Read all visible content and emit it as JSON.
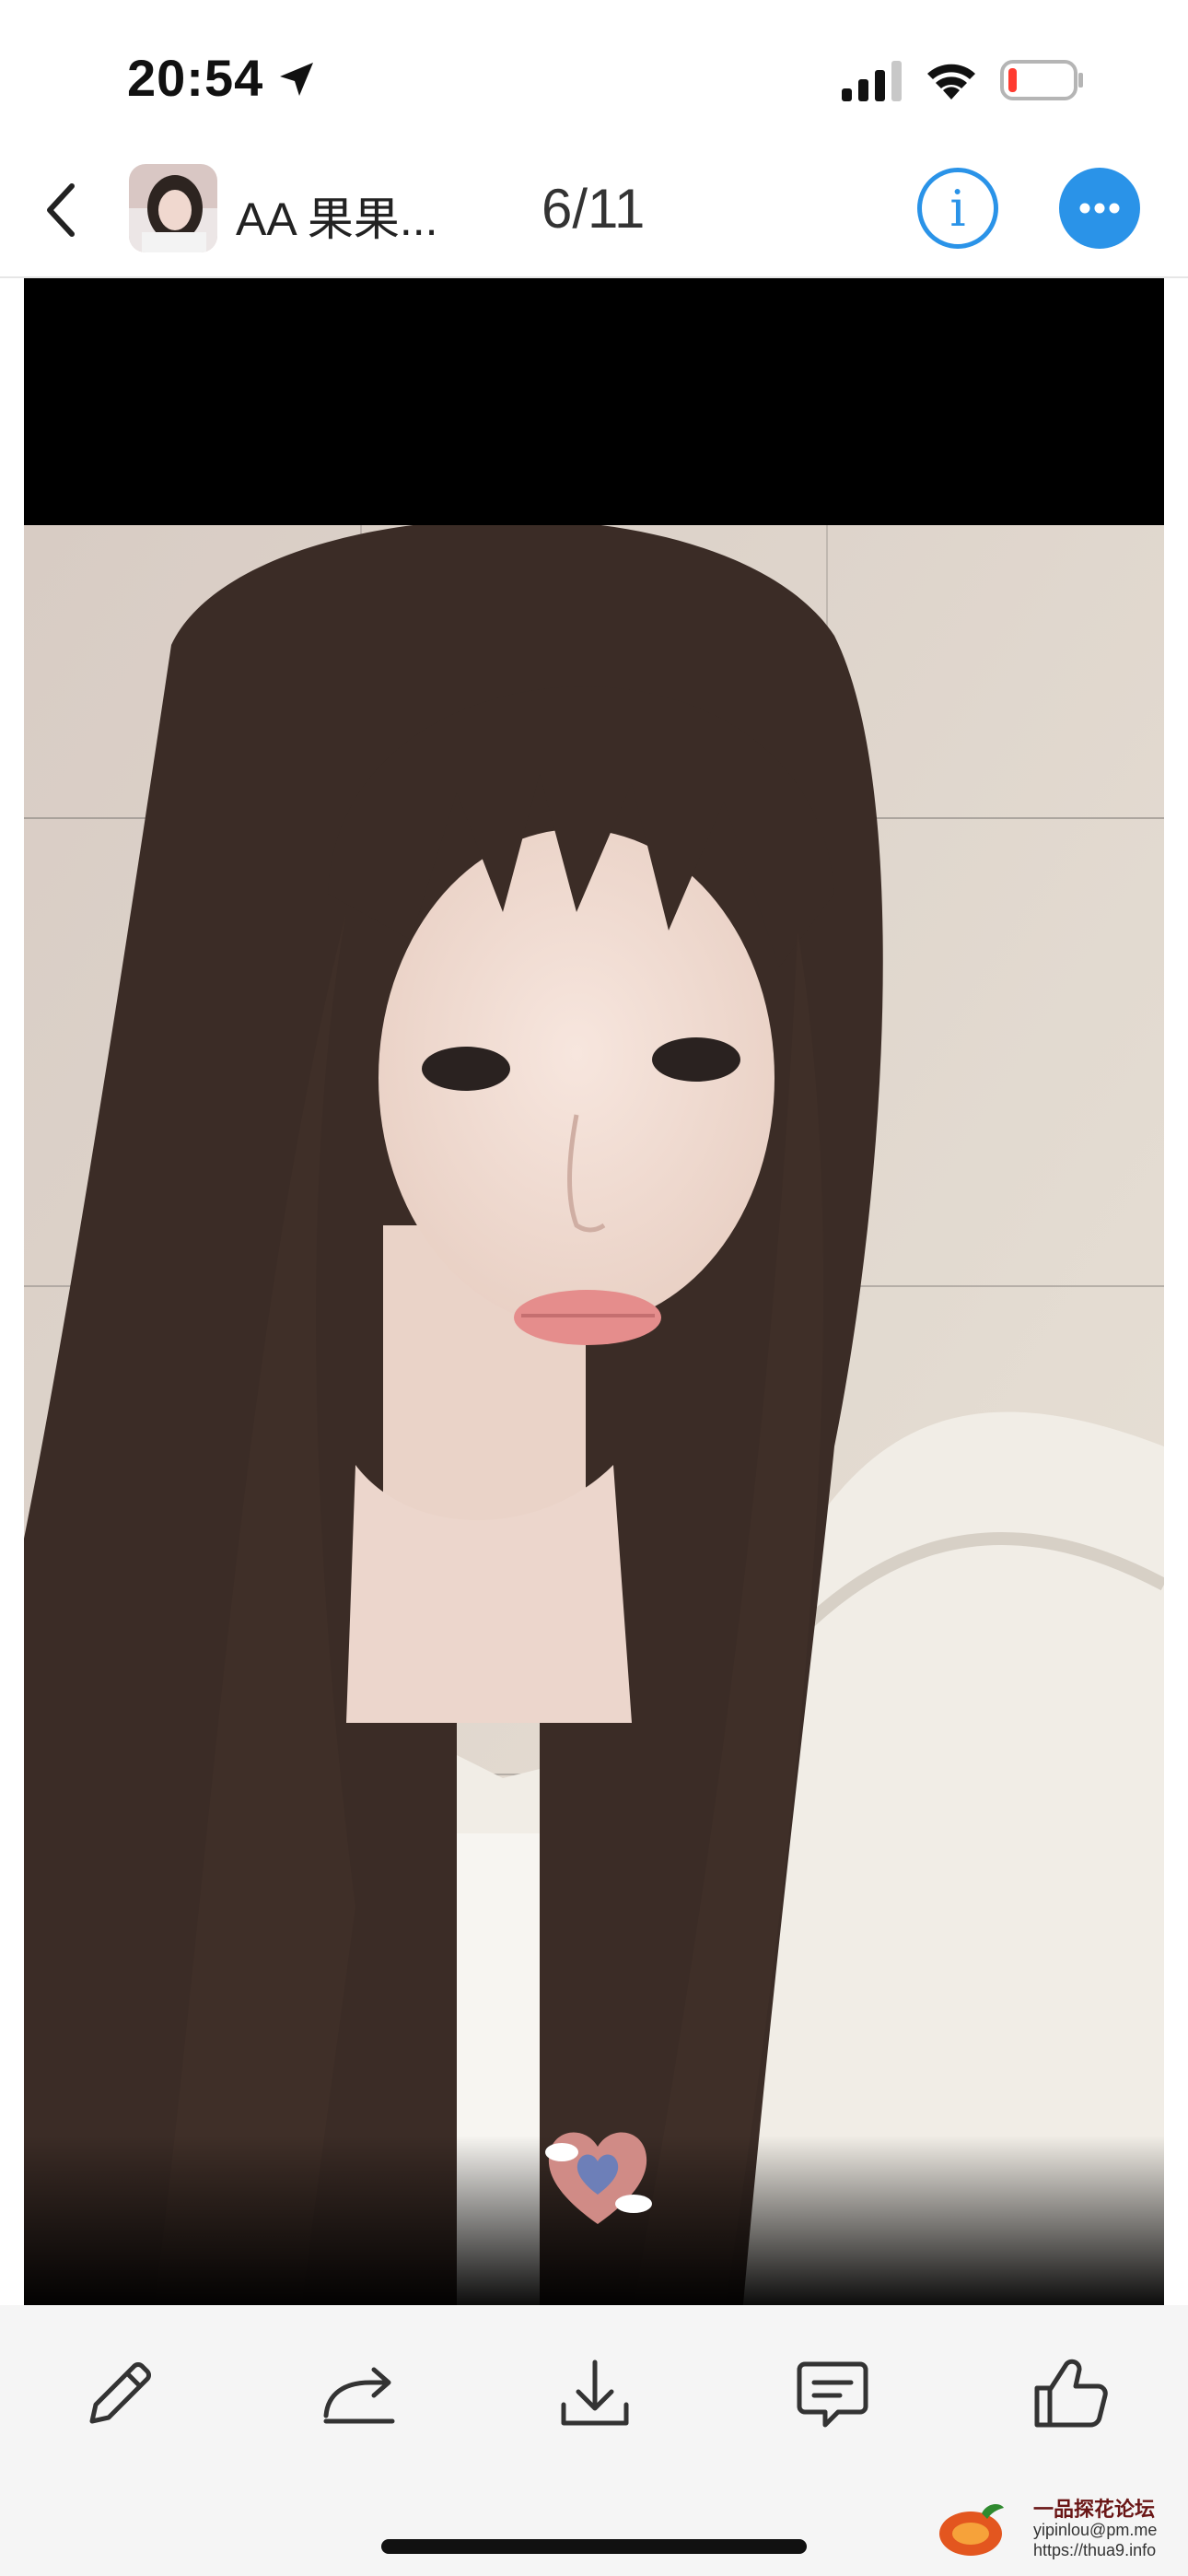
{
  "status_bar": {
    "time": "20:54",
    "location_icon": "location-arrow-icon",
    "signal_icon": "cellular-signal-icon",
    "wifi_icon": "wifi-icon",
    "battery_icon": "battery-low-icon",
    "battery_level": 0.1,
    "battery_color": "#ff3b30"
  },
  "nav": {
    "back_icon": "chevron-left-icon",
    "title": "AA 果果...",
    "page_counter": "6/11",
    "info_icon": "info-icon",
    "more_icon": "ellipsis-icon",
    "accent_color": "#2a93e8"
  },
  "viewer": {
    "sticker": "heart-sticker"
  },
  "toolbar": {
    "items": [
      {
        "name": "edit",
        "icon": "pencil-icon"
      },
      {
        "name": "share",
        "icon": "share-forward-icon"
      },
      {
        "name": "download",
        "icon": "download-icon"
      },
      {
        "name": "comment",
        "icon": "comment-icon"
      },
      {
        "name": "like",
        "icon": "thumbs-up-icon"
      }
    ]
  },
  "watermark": {
    "title": "一品探花论坛",
    "line1": "yipinlou@pm.me",
    "line2": "https://thua9.info"
  }
}
